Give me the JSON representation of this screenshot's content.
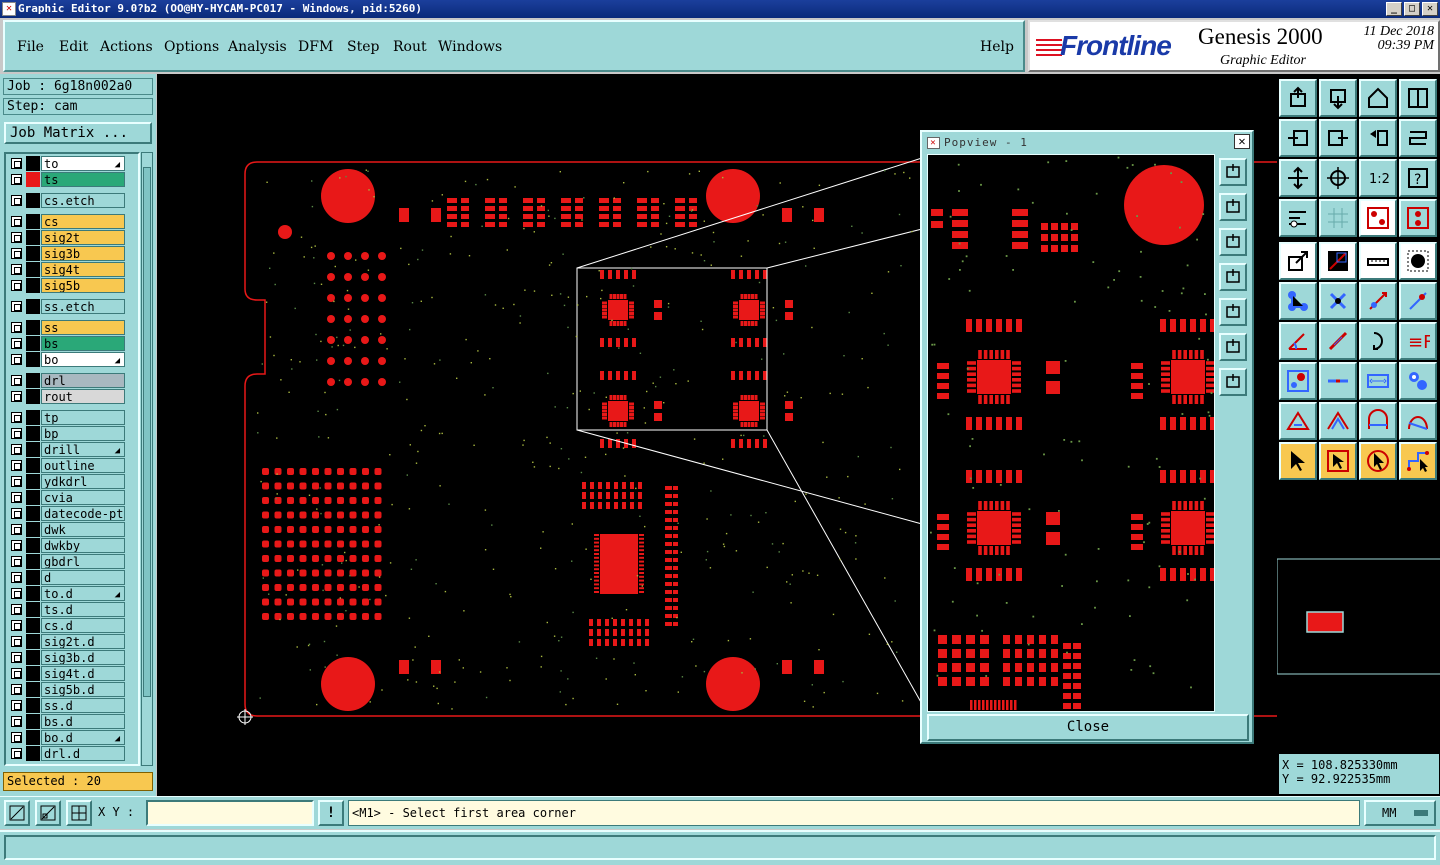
{
  "window": {
    "title": "Graphic Editor 9.0?b2 (OO@HY-HYCAM-PC017 - Windows, pid:5260)"
  },
  "menu": {
    "items": [
      "File",
      "Edit",
      "Actions",
      "Options",
      "Analysis",
      "DFM",
      "Step",
      "Rout",
      "Windows"
    ],
    "help": "Help"
  },
  "brand": {
    "logo": "Frontline",
    "product": "Genesis 2000",
    "subtitle": "Graphic Editor",
    "date": "11 Dec 2018",
    "time": "09:39 PM"
  },
  "left": {
    "job": "Job : 6g18n002a0",
    "step": "Step: cam",
    "job_matrix": "Job Matrix ...",
    "selected": "Selected : 20",
    "layers": [
      {
        "name": "to",
        "color": "#ffffff",
        "swatch": "#000000",
        "tick": true
      },
      {
        "name": "ts",
        "color": "#2aa878",
        "swatch": "#e81818",
        "tick": false
      },
      {
        "name": "cs.etch",
        "color": "#9ed8d8",
        "swatch": "#000000",
        "tick": false,
        "gap": true
      },
      {
        "name": "cs",
        "color": "#f8c850",
        "swatch": "#000000",
        "tick": false,
        "gap": true
      },
      {
        "name": "sig2t",
        "color": "#f8c850",
        "swatch": "#000000",
        "tick": false
      },
      {
        "name": "sig3b",
        "color": "#f8c850",
        "swatch": "#000000",
        "tick": false
      },
      {
        "name": "sig4t",
        "color": "#f8c850",
        "swatch": "#000000",
        "tick": false
      },
      {
        "name": "sig5b",
        "color": "#f8c850",
        "swatch": "#000000",
        "tick": false
      },
      {
        "name": "ss.etch",
        "color": "#9ed8d8",
        "swatch": "#000000",
        "tick": false,
        "gap": true
      },
      {
        "name": "ss",
        "color": "#f8c850",
        "swatch": "#000000",
        "tick": false,
        "gap": true
      },
      {
        "name": "bs",
        "color": "#2aa878",
        "swatch": "#000000",
        "tick": false
      },
      {
        "name": "bo",
        "color": "#ffffff",
        "swatch": "#000000",
        "tick": true
      },
      {
        "name": "drl",
        "color": "#a8b8c0",
        "swatch": "#000000",
        "tick": false,
        "gap": true
      },
      {
        "name": "rout",
        "color": "#d8d8d8",
        "swatch": "#000000",
        "tick": false
      },
      {
        "name": "tp",
        "color": "#9ed8d8",
        "swatch": "#000000",
        "tick": false,
        "gap": true
      },
      {
        "name": "bp",
        "color": "#9ed8d8",
        "swatch": "#000000",
        "tick": false
      },
      {
        "name": "drill",
        "color": "#9ed8d8",
        "swatch": "#000000",
        "tick": true
      },
      {
        "name": "outline",
        "color": "#9ed8d8",
        "swatch": "#000000",
        "tick": false
      },
      {
        "name": "ydkdrl",
        "color": "#9ed8d8",
        "swatch": "#000000",
        "tick": false
      },
      {
        "name": "cvia",
        "color": "#9ed8d8",
        "swatch": "#000000",
        "tick": false
      },
      {
        "name": "datecode-pto",
        "color": "#9ed8d8",
        "swatch": "#000000",
        "tick": false
      },
      {
        "name": "dwk",
        "color": "#9ed8d8",
        "swatch": "#000000",
        "tick": false
      },
      {
        "name": "dwkby",
        "color": "#9ed8d8",
        "swatch": "#000000",
        "tick": false
      },
      {
        "name": "gbdrl",
        "color": "#9ed8d8",
        "swatch": "#000000",
        "tick": false
      },
      {
        "name": "d",
        "color": "#9ed8d8",
        "swatch": "#000000",
        "tick": false
      },
      {
        "name": "to.d",
        "color": "#9ed8d8",
        "swatch": "#000000",
        "tick": true
      },
      {
        "name": "ts.d",
        "color": "#9ed8d8",
        "swatch": "#000000",
        "tick": false
      },
      {
        "name": "cs.d",
        "color": "#9ed8d8",
        "swatch": "#000000",
        "tick": false
      },
      {
        "name": "sig2t.d",
        "color": "#9ed8d8",
        "swatch": "#000000",
        "tick": false
      },
      {
        "name": "sig3b.d",
        "color": "#9ed8d8",
        "swatch": "#000000",
        "tick": false
      },
      {
        "name": "sig4t.d",
        "color": "#9ed8d8",
        "swatch": "#000000",
        "tick": false
      },
      {
        "name": "sig5b.d",
        "color": "#9ed8d8",
        "swatch": "#000000",
        "tick": false
      },
      {
        "name": "ss.d",
        "color": "#9ed8d8",
        "swatch": "#000000",
        "tick": false
      },
      {
        "name": "bs.d",
        "color": "#9ed8d8",
        "swatch": "#000000",
        "tick": false
      },
      {
        "name": "bo.d",
        "color": "#9ed8d8",
        "swatch": "#000000",
        "tick": true
      },
      {
        "name": "drl.d",
        "color": "#9ed8d8",
        "swatch": "#000000",
        "tick": false
      }
    ]
  },
  "popview": {
    "title": "Popview - 1",
    "close_x": "✕",
    "close_label": "Close"
  },
  "coords": {
    "x": "X = 108.825330mm",
    "y": "Y = 92.922535mm"
  },
  "status": {
    "xy_label": "X Y :",
    "xy_value": "",
    "message": "<M1> - Select first area corner",
    "units": "MM",
    "bang": "!"
  },
  "colors": {
    "panel": "#9ed8d8",
    "copper": "#e81818",
    "highlight": "#f8c850"
  },
  "icons": {
    "toolbar": [
      "top-view-icon",
      "bottom-view-icon",
      "home-icon",
      "split-view-icon",
      "pan-left-icon",
      "pan-right-icon",
      "rotate-icon",
      "mirror-icon",
      "zoom-fit-icon",
      "center-icon",
      "scale-1-2-icon",
      "help-icon",
      "measure-icon",
      "grid-icon",
      "layers-icon",
      "snap-icon",
      "pointer-icon",
      "select-box-icon",
      "ruler-icon",
      "circle-icon",
      "connect-icon",
      "close-icon",
      "line-pad-icon",
      "pad-line-icon",
      "angle-icon",
      "slash-icon",
      "arc-icon",
      "text-icon",
      "pad-icon",
      "line-icon",
      "dimension-icon",
      "group-icon",
      "triangle-icon",
      "triangle2-icon",
      "arch-icon",
      "arch2-icon",
      "arrow-select-icon",
      "arrow-box-icon",
      "arrow-circle-icon",
      "path-icon"
    ]
  }
}
